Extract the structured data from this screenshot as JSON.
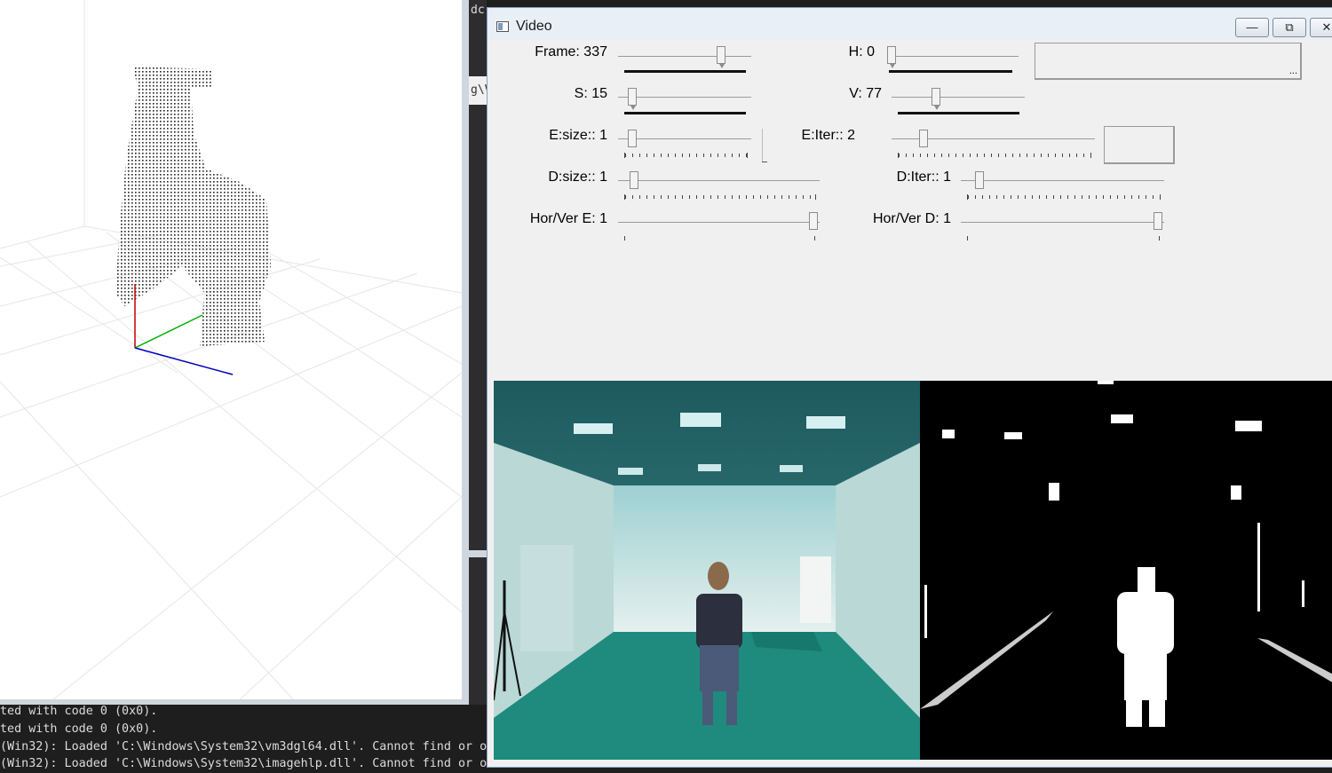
{
  "console": {
    "lines": [
      "ted with code 0 (0x0).",
      "ted with code 0 (0x0).",
      " (Win32): Loaded 'C:\\Windows\\System32\\vm3dgl64.dll'. Cannot find or o",
      " (Win32): Loaded 'C:\\Windows\\System32\\imagehlp.dll'. Cannot find or o"
    ]
  },
  "vs_fragments": [
    "dc",
    "g\\V"
  ],
  "video_window": {
    "title": "Video",
    "controls": {
      "minimize_icon": "minimize-icon",
      "maximize_icon": "maximize-icon",
      "close_icon": "close-icon",
      "minimize_glyph": "—",
      "maximize_glyph": "⧉",
      "close_glyph": "✕"
    },
    "panel_glyph": "..."
  },
  "trackbars": [
    {
      "label": "Frame: 337",
      "value": 337
    },
    {
      "label": "H: 0",
      "value": 0
    },
    {
      "label": "S: 15",
      "value": 15
    },
    {
      "label": "V: 77",
      "value": 77
    },
    {
      "label": "E:size:: 1",
      "value": 1
    },
    {
      "label": "E:Iter:: 2",
      "value": 2
    },
    {
      "label": "D:size:: 1",
      "value": 1
    },
    {
      "label": "D:Iter:: 1",
      "value": 1
    },
    {
      "label": "Hor/Ver E: 1",
      "value": 1
    },
    {
      "label": "Hor/Ver D: 1",
      "value": 1
    }
  ],
  "colors": {
    "window_border": "#8aa1c4",
    "floor": "#1f8a7e",
    "wall": "#d9ecec"
  }
}
